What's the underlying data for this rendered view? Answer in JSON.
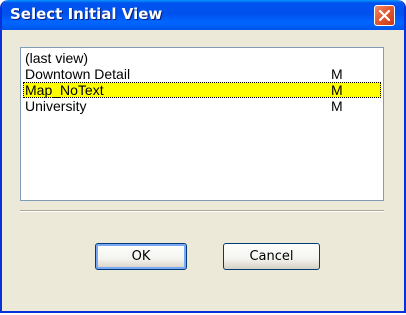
{
  "window": {
    "title": "Select Initial View"
  },
  "icons": {
    "close": "close-icon"
  },
  "colors": {
    "titlebar": "#0054e3",
    "selection": "#ffff00",
    "dialog_bg": "#ece9d8"
  },
  "list": {
    "items": [
      {
        "name": "(last view)",
        "flag": ""
      },
      {
        "name": "Downtown Detail",
        "flag": "M"
      },
      {
        "name": "Map_NoText",
        "flag": "M"
      },
      {
        "name": "University",
        "flag": "M"
      }
    ],
    "selected_index": 2
  },
  "buttons": {
    "ok_label": "OK",
    "cancel_label": "Cancel"
  }
}
